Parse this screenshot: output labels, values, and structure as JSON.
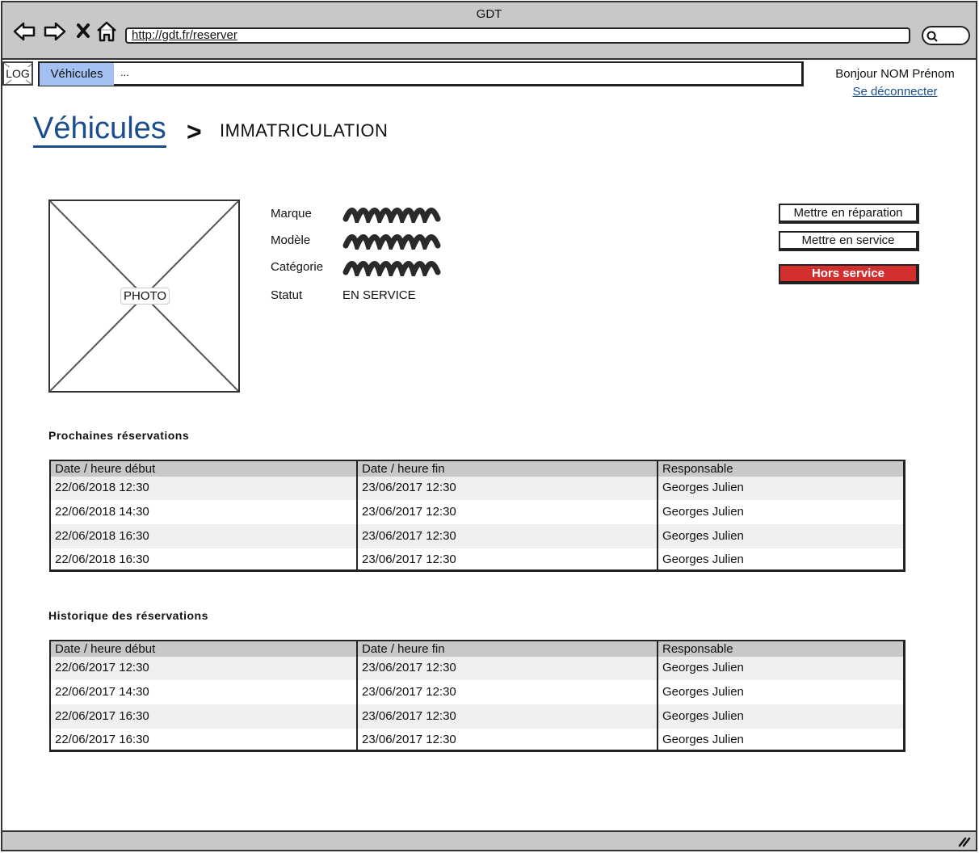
{
  "window": {
    "title": "GDT",
    "url": "http://gdt.fr/reserver"
  },
  "icons": {
    "back": "arrow-left-icon",
    "forward": "arrow-right-icon",
    "stop": "close-icon",
    "home": "home-icon",
    "search": "search-icon"
  },
  "appbar": {
    "logo": "LOG",
    "active_menu": "Véhicules",
    "more": "...",
    "greeting": "Bonjour NOM Prénom",
    "logout": "Se déconnecter"
  },
  "breadcrumb": {
    "parent": "Véhicules",
    "separator": ">",
    "current": "IMMATRICULATION"
  },
  "vehicle": {
    "photo_label": "PHOTO",
    "labels": {
      "brand": "Marque",
      "model": "Modèle",
      "category": "Catégorie",
      "status": "Statut"
    },
    "status_value": "EN SERVICE"
  },
  "actions": {
    "repair": "Mettre en réparation",
    "service": "Mettre en service",
    "out_of_service": "Hors service"
  },
  "colors": {
    "link": "#1a4c8e",
    "menu_active": "#a3c1f2",
    "danger": "#d32f2f",
    "chrome": "#c8c8c8"
  },
  "upcoming": {
    "title": "Prochaines réservations",
    "headers": [
      "Date / heure début",
      "Date / heure fin",
      "Responsable"
    ],
    "rows": [
      [
        "22/06/2018 12:30",
        "23/06/2017 12:30",
        "Georges Julien"
      ],
      [
        "22/06/2018 14:30",
        "23/06/2017 12:30",
        "Georges Julien"
      ],
      [
        "22/06/2018 16:30",
        "23/06/2017 12:30",
        "Georges Julien"
      ],
      [
        "22/06/2018 16:30",
        "23/06/2017 12:30",
        "Georges Julien"
      ]
    ]
  },
  "history": {
    "title": "Historique des réservations",
    "headers": [
      "Date / heure début",
      "Date / heure fin",
      "Responsable"
    ],
    "rows": [
      [
        "22/06/2017 12:30",
        "23/06/2017 12:30",
        "Georges Julien"
      ],
      [
        "22/06/2017 14:30",
        "23/06/2017 12:30",
        "Georges Julien"
      ],
      [
        "22/06/2017 16:30",
        "23/06/2017 12:30",
        "Georges Julien"
      ],
      [
        "22/06/2017 16:30",
        "23/06/2017 12:30",
        "Georges Julien"
      ]
    ]
  }
}
